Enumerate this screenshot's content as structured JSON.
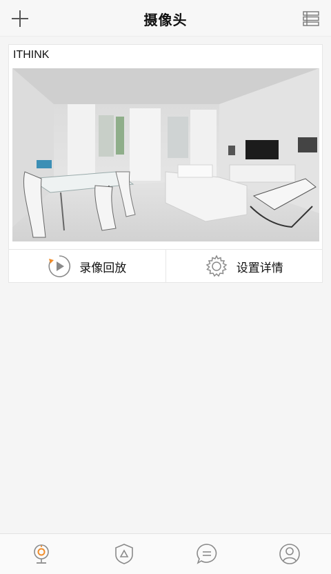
{
  "header": {
    "title": "摄像头",
    "add_icon": "plus-icon",
    "list_icon": "list-icon"
  },
  "camera_card": {
    "name": "ITHINK",
    "preview_description_icon": "camera-preview-image",
    "actions": [
      {
        "label": "录像回放",
        "icon": "playback-icon"
      },
      {
        "label": "设置详情",
        "icon": "gear-icon"
      }
    ]
  },
  "tabbar": {
    "tabs": [
      {
        "icon": "webcam-icon",
        "active": true
      },
      {
        "icon": "shield-icon",
        "active": false
      },
      {
        "icon": "chat-icon",
        "active": false
      },
      {
        "icon": "user-icon",
        "active": false
      }
    ]
  },
  "colors": {
    "accent": "#f08c2a",
    "icon_gray": "#8a8a8a",
    "background": "#f5f5f5"
  }
}
